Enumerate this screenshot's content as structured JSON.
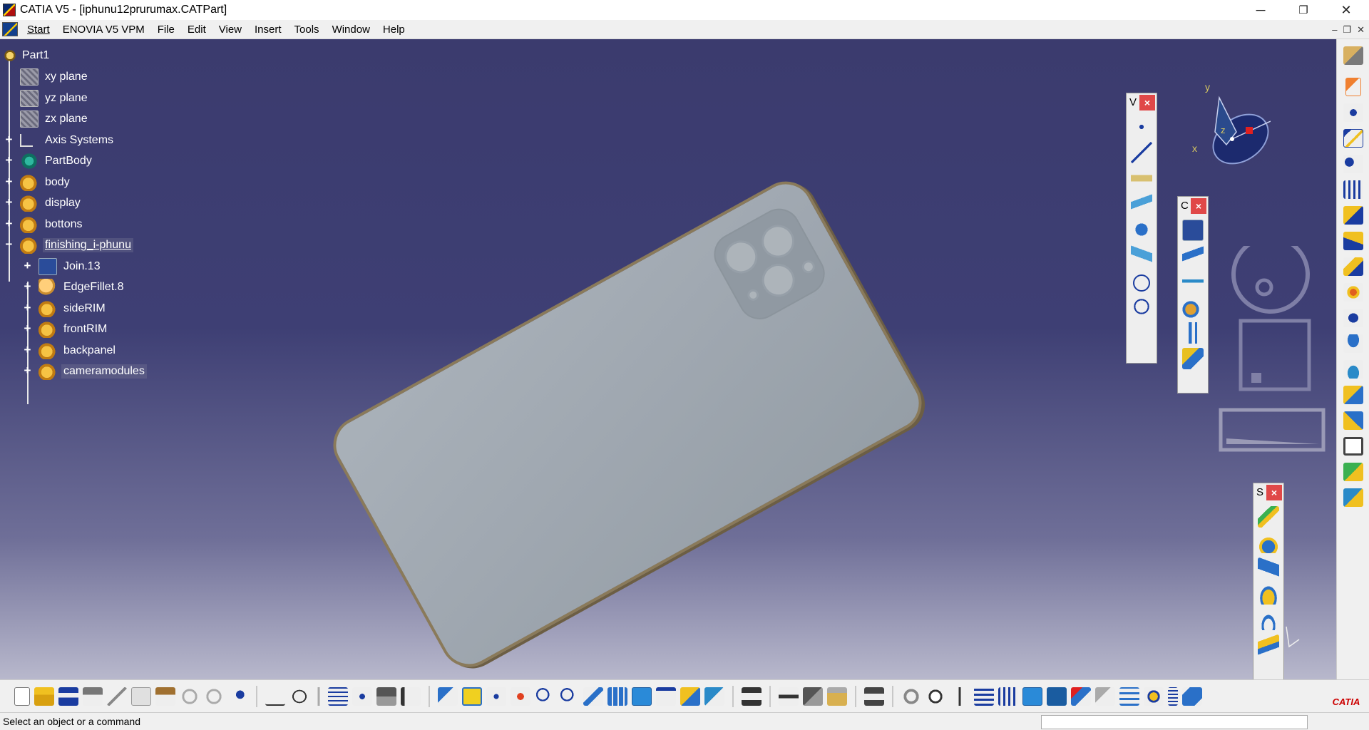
{
  "window": {
    "title": "CATIA V5 - [iphunu12prurumax.CATPart]",
    "controls": [
      "─",
      "❐",
      "✕"
    ]
  },
  "menubar": {
    "items": [
      {
        "label": "Start",
        "name": "menu-start"
      },
      {
        "label": "ENOVIA V5 VPM",
        "name": "menu-enovia"
      },
      {
        "label": "File",
        "name": "menu-file"
      },
      {
        "label": "Edit",
        "name": "menu-edit"
      },
      {
        "label": "View",
        "name": "menu-view"
      },
      {
        "label": "Insert",
        "name": "menu-insert"
      },
      {
        "label": "Tools",
        "name": "menu-tools"
      },
      {
        "label": "Window",
        "name": "menu-window"
      },
      {
        "label": "Help",
        "name": "menu-help"
      }
    ],
    "mdi_controls": [
      "–",
      "❐",
      "✕"
    ]
  },
  "tree": {
    "root": "Part1",
    "nodes": [
      {
        "label": "xy plane",
        "icon": "plane-icon",
        "expandable": false
      },
      {
        "label": "yz plane",
        "icon": "plane-icon",
        "expandable": false
      },
      {
        "label": "zx plane",
        "icon": "plane-icon",
        "expandable": false
      },
      {
        "label": "Axis Systems",
        "icon": "axis-icon",
        "expandable": true
      },
      {
        "label": "PartBody",
        "icon": "partbody-icon",
        "expandable": true
      },
      {
        "label": "body",
        "icon": "geometrical-set-icon",
        "expandable": true
      },
      {
        "label": "display",
        "icon": "geometrical-set-icon",
        "expandable": true
      },
      {
        "label": "bottons",
        "icon": "geometrical-set-icon",
        "expandable": true
      },
      {
        "label": "finishing_i-phunu",
        "icon": "geometrical-set-icon",
        "expandable": true,
        "expanded": true,
        "selected": true
      }
    ],
    "children": [
      {
        "label": "Join.13",
        "icon": "join-icon"
      },
      {
        "label": "EdgeFillet.8",
        "icon": "edge-fillet-icon"
      },
      {
        "label": "sideRIM",
        "icon": "geometrical-set-icon"
      },
      {
        "label": "frontRIM",
        "icon": "geometrical-set-icon"
      },
      {
        "label": "backpanel",
        "icon": "geometrical-set-icon"
      },
      {
        "label": "cameramodules",
        "icon": "geometrical-set-icon"
      }
    ]
  },
  "compass": {
    "x": "x",
    "y": "y",
    "z": "z"
  },
  "toolbars": {
    "v": {
      "title": "V",
      "close": "×"
    },
    "c": {
      "title": "C",
      "close": "×"
    },
    "s": {
      "title": "S",
      "close": "×"
    }
  },
  "status": {
    "text": "Select an object or a command",
    "input_value": ""
  },
  "brand": {
    "logo_text": "CATIA"
  },
  "colors": {
    "viewport_top": "#3b3b6e",
    "viewport_bottom": "#b8b8cc",
    "close_red": "#e04848",
    "model_gray": "#9fa7b0"
  }
}
